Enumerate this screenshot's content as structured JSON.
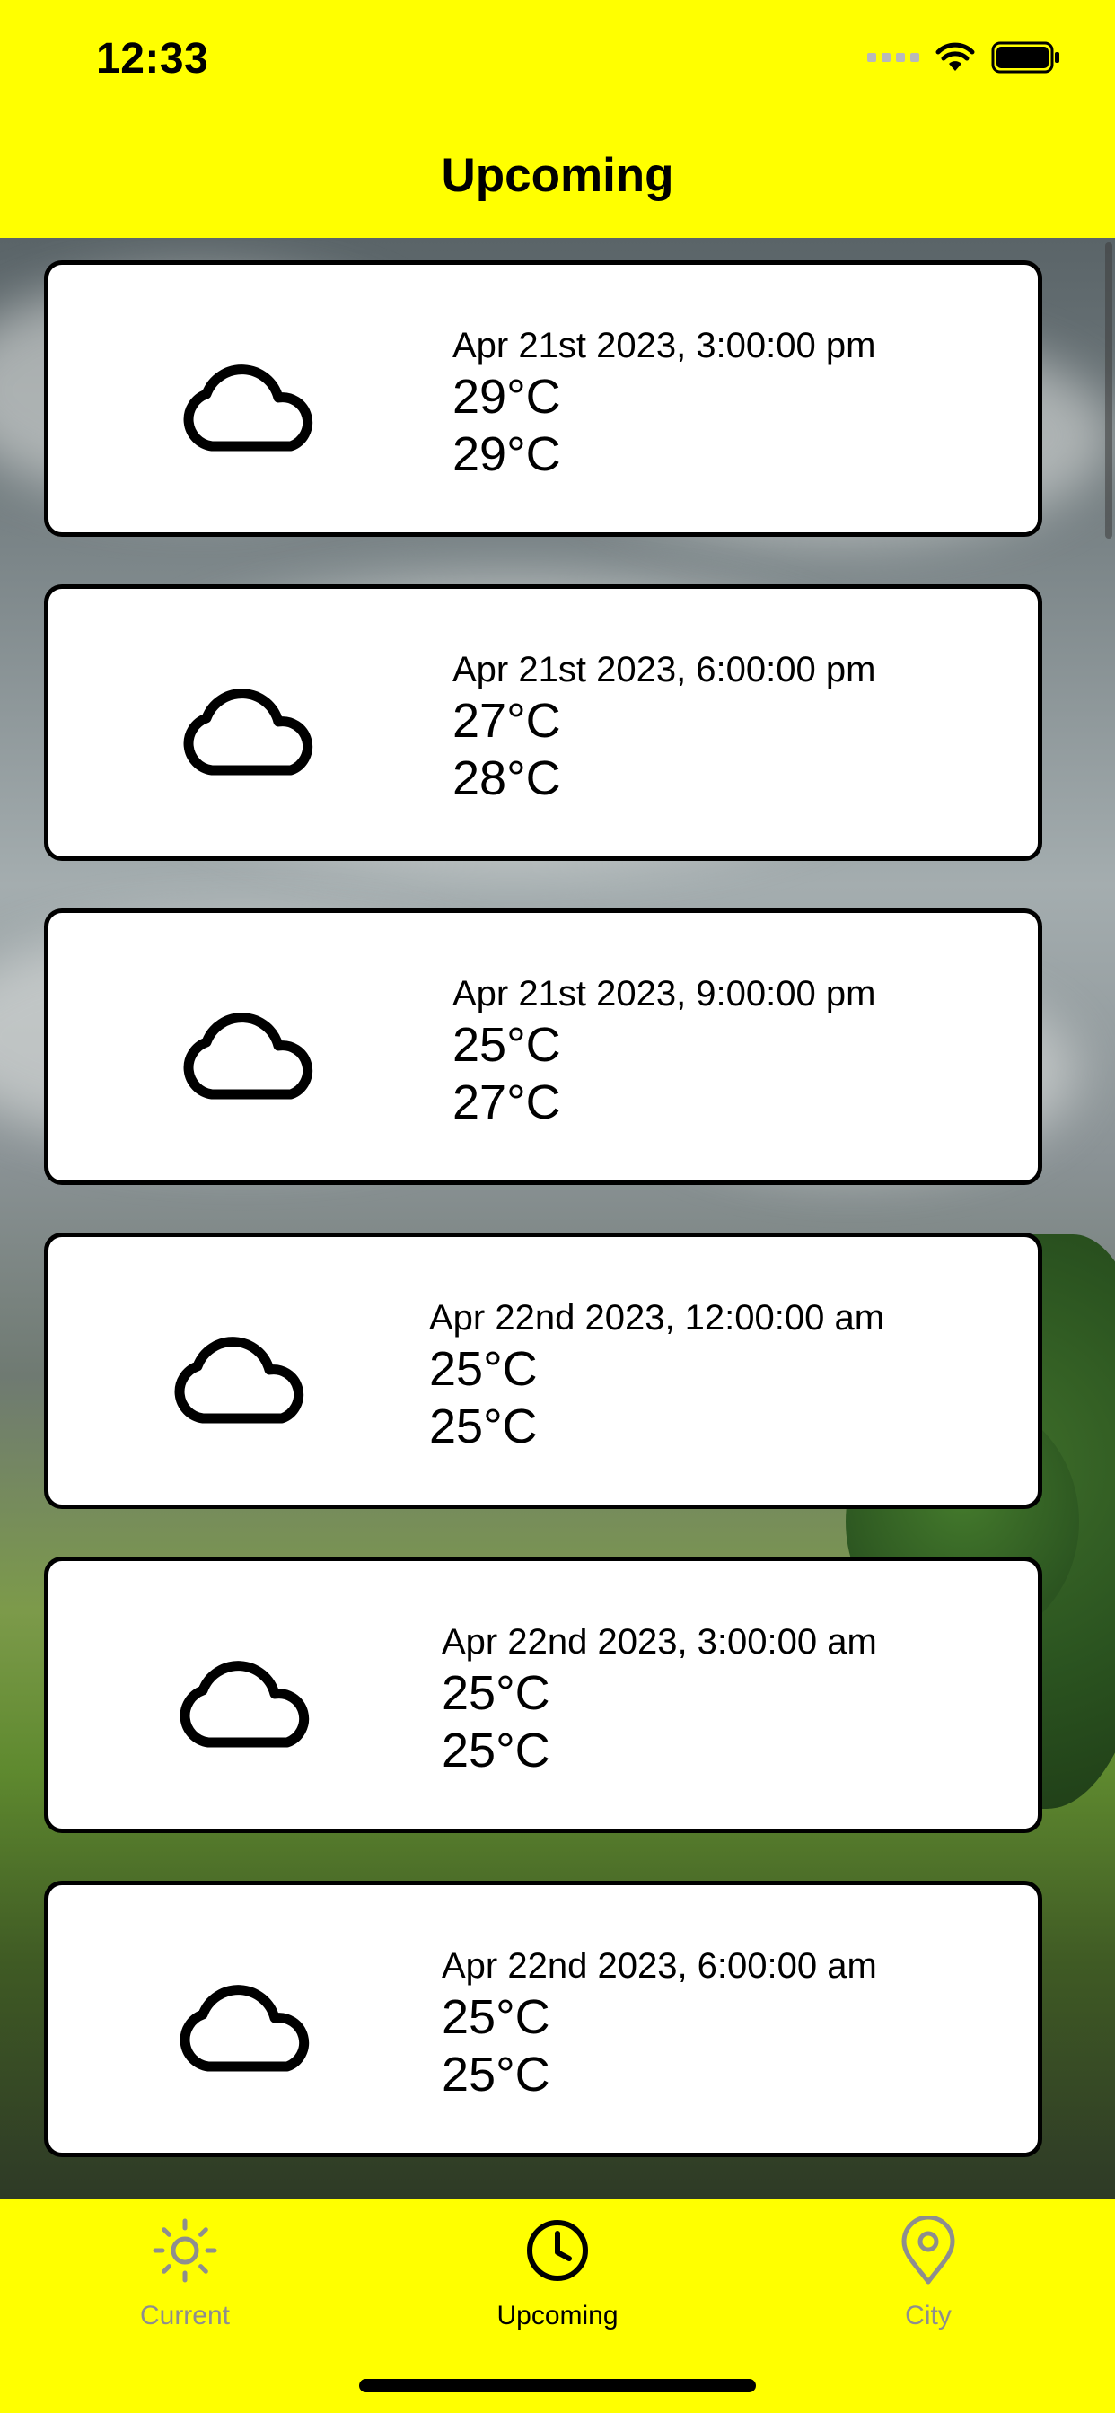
{
  "status_bar": {
    "time": "12:33"
  },
  "nav": {
    "title": "Upcoming"
  },
  "forecasts": [
    {
      "datetime": "Apr 21st 2023, 3:00:00 pm",
      "temp_1": "29°C",
      "temp_2": "29°C",
      "icon": "cloud-icon"
    },
    {
      "datetime": "Apr 21st 2023, 6:00:00 pm",
      "temp_1": "27°C",
      "temp_2": "28°C",
      "icon": "cloud-icon"
    },
    {
      "datetime": "Apr 21st 2023, 9:00:00 pm",
      "temp_1": "25°C",
      "temp_2": "27°C",
      "icon": "cloud-icon"
    },
    {
      "datetime": "Apr 22nd 2023, 12:00:00 am",
      "temp_1": "25°C",
      "temp_2": "25°C",
      "icon": "cloud-icon"
    },
    {
      "datetime": "Apr 22nd 2023, 3:00:00 am",
      "temp_1": "25°C",
      "temp_2": "25°C",
      "icon": "cloud-icon"
    },
    {
      "datetime": "Apr 22nd 2023, 6:00:00 am",
      "temp_1": "25°C",
      "temp_2": "25°C",
      "icon": "cloud-icon"
    }
  ],
  "tabbar": {
    "tabs": [
      {
        "label": "Current",
        "icon": "sun-icon",
        "active": false
      },
      {
        "label": "Upcoming",
        "icon": "clock-icon",
        "active": true
      },
      {
        "label": "City",
        "icon": "location-pin-icon",
        "active": false
      }
    ]
  },
  "colors": {
    "accent": "#FFFF00",
    "card_background": "#FFFFFF",
    "card_border": "#000000",
    "tab_active": "#000000",
    "tab_inactive": "#8E8E8E"
  }
}
